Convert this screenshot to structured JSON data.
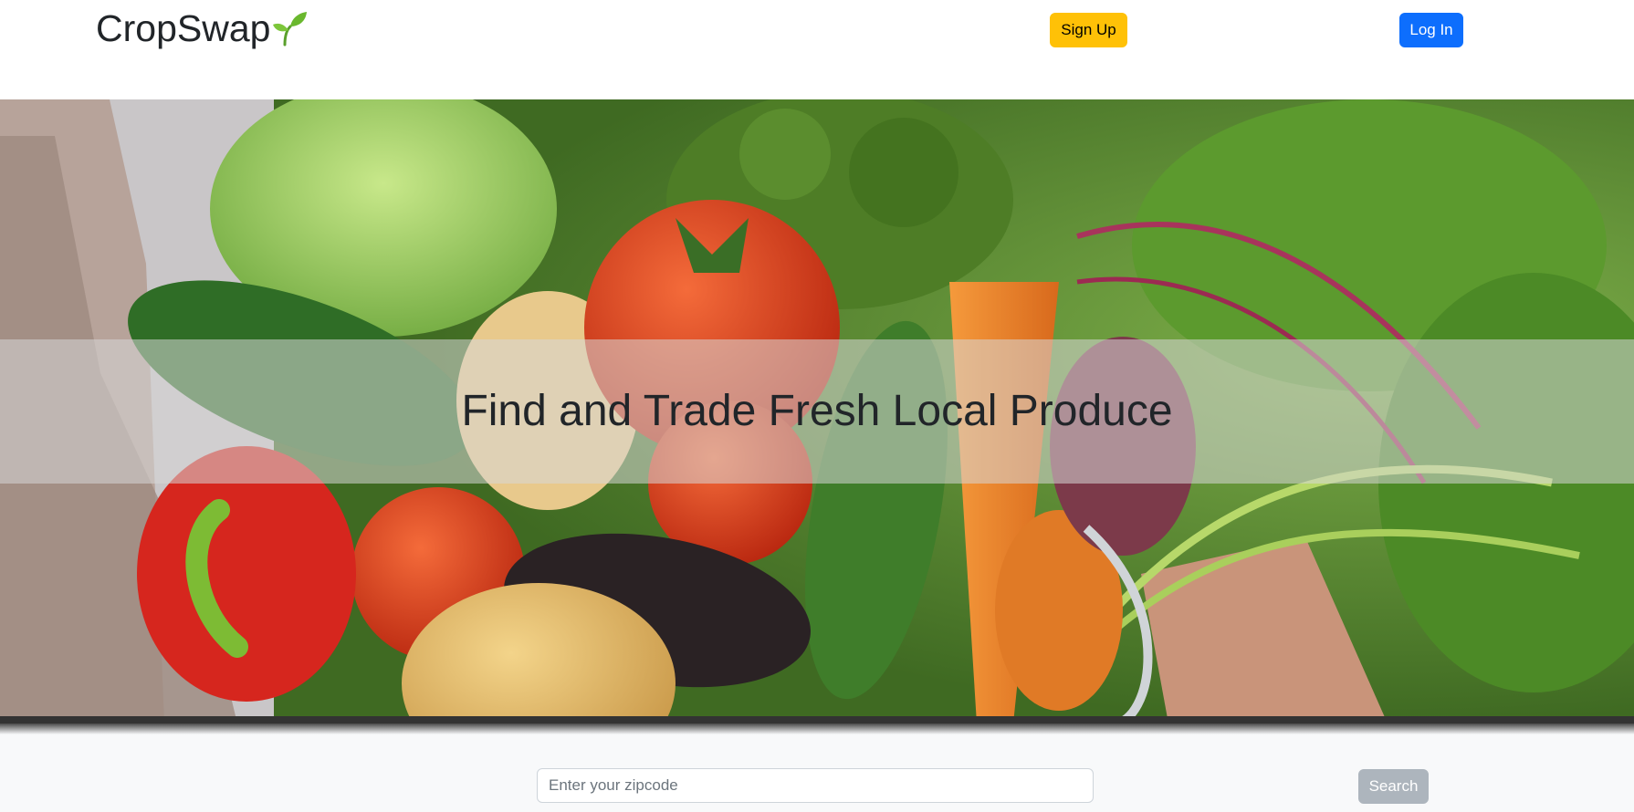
{
  "navbar": {
    "brand": "CropSwap",
    "brand_icon": "seedling-icon",
    "signup_label": "Sign Up",
    "login_label": "Log In"
  },
  "hero": {
    "title": "Find and Trade Fresh Local Produce",
    "image": "basket-of-fresh-vegetables"
  },
  "search": {
    "placeholder": "Enter your zipcode",
    "value": "",
    "button_label": "Search"
  },
  "colors": {
    "signup": "#ffc107",
    "login": "#0d6efd",
    "search_button": "#adb5bd"
  }
}
